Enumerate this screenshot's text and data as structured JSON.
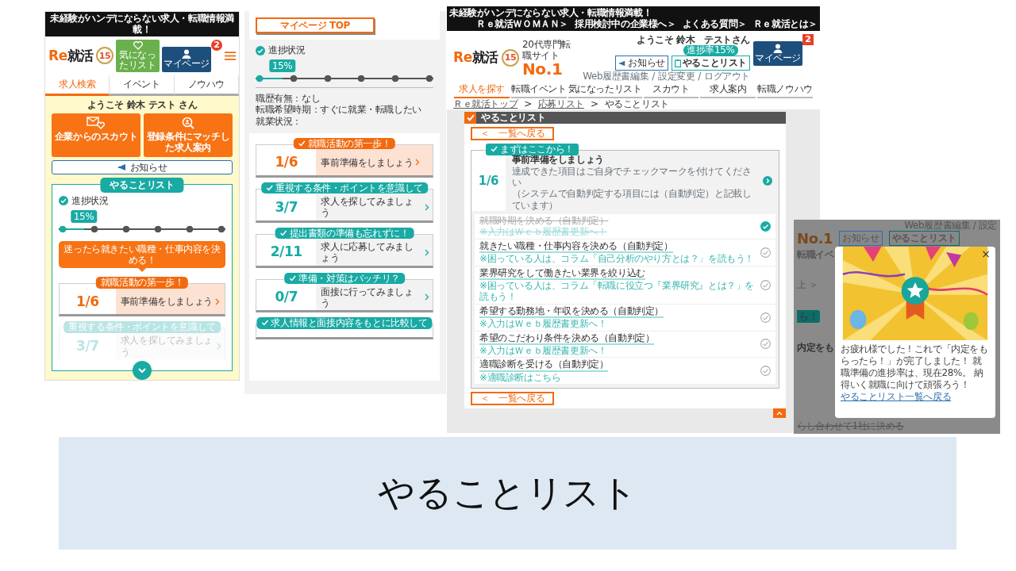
{
  "mobile_screen": {
    "top_banner": "未経験がハンデにならない求人・転職情報満載！",
    "logo": {
      "latin": "Re",
      "kanji": "就活"
    },
    "anniversary_badge": "15",
    "favorites_button": "気になったリスト",
    "mypage_button": "マイページ",
    "mypage_badge": "2",
    "tabs": [
      {
        "label": "求人検索",
        "selected": true
      },
      {
        "label": "イベント",
        "selected": false
      },
      {
        "label": "ノウハウ",
        "selected": false
      }
    ],
    "welcome": "ようこそ 鈴木 テスト さん",
    "action_buttons": [
      {
        "kind": "scout",
        "label": "企業からのスカウト"
      },
      {
        "kind": "match",
        "label": "登録条件にマッチした求人案内"
      }
    ],
    "notice_button": "お知らせ",
    "todo": {
      "title": "やることリスト",
      "progress": {
        "label": "進捗状況",
        "reading": "15%",
        "level": 0.15
      },
      "tip": "迷ったら就きたい職種・仕事内容を決める！",
      "steps": [
        {
          "tag": "就職活動の第一歩！",
          "count": "1/6",
          "action": "事前準備をしましょう",
          "current": true,
          "faded": false
        },
        {
          "tag": "重視する条件・ポイントを意識して",
          "count": "3/7",
          "action": "求人を探してみましょう",
          "current": false,
          "faded": true
        }
      ]
    }
  },
  "mypage_screen": {
    "top_button": "マイページ TOP",
    "progress": {
      "label": "進捗状況",
      "reading": "15%",
      "level": 0.15
    },
    "profile": [
      "職歴有無：なし",
      "転職希望時期：すぐに就業・転職したい",
      "就業状況："
    ],
    "steps": [
      {
        "tag": "就職活動の第一歩！",
        "count": "1/6",
        "action": "事前準備をしましょう",
        "current": true
      },
      {
        "tag": "重視する条件・ポイントを意識して",
        "count": "3/7",
        "action": "求人を探してみましょう",
        "current": false
      },
      {
        "tag": "提出書類の準備も忘れずに！",
        "count": "2/11",
        "action": "求人に応募してみましょう",
        "current": false
      },
      {
        "tag": "準備・対策はバッチリ？",
        "count": "0/7",
        "action": "面接に行ってみましょう",
        "current": false
      },
      {
        "tag": "求人情報と面接内容をもとに比較して",
        "current": false
      }
    ]
  },
  "desktop_screen": {
    "top_banner": "未経験がハンデにならない求人・転職情報満載！",
    "top_links": [
      "Ｒｅ就活ＷＯＭＡＮ＞",
      "採用検討中の企業様へ＞",
      "よくある質問＞",
      "Ｒｅ就活とは＞"
    ],
    "logo": {
      "latin": "Re",
      "kanji": "就活"
    },
    "anniversary_badge": "15",
    "tagline": "20代専門転職サイト",
    "rank": "No.1",
    "notice_button": "お知らせ",
    "todo_button": "やることリスト",
    "todo_progress": "進捗率15%",
    "greeting": "ようこそ 鈴木　テストさん",
    "account_links": [
      "Web履歴書編集",
      "設定変更",
      "ログアウト"
    ],
    "link_separator": "/",
    "mypage_button": "マイページ",
    "mypage_badge": "2",
    "nav": [
      {
        "label": "求人を探す",
        "selected": true
      },
      {
        "label": "転職イベント",
        "selected": false
      },
      {
        "label": "気になったリスト",
        "selected": false
      },
      {
        "label": "スカウト",
        "selected": false
      },
      {
        "label": "求人案内",
        "selected": false
      },
      {
        "label": "転職ノウハウ",
        "selected": false
      }
    ],
    "breadcrumb": [
      "Ｒｅ就活トップ",
      "応募リスト",
      "やることリスト"
    ],
    "breadcrumb_separator": ">",
    "section_title": "やることリスト",
    "back_buttons": [
      "＜　一覧へ戻る",
      "＜　一覧へ戻る"
    ],
    "step": {
      "tag": "まずはここから！",
      "count": "1/6",
      "title": "事前準備をしましょう",
      "notes": [
        "達成できた項目はご自身でチェックマークを付けてください",
        "（システムで自動判定する項目には（自動判定）と記載しています）"
      ]
    },
    "tasks": [
      {
        "title": "就職時期を決める（自動判定）",
        "note": "※入力はＷｅｂ履歴書更新へ！",
        "done": true
      },
      {
        "title": "就きたい職種・仕事内容を決める（自動判定）",
        "note": "※困っている人は、コラム「自己分析のやり方とは？」を読もう！",
        "done": false
      },
      {
        "title": "業界研究をして働きたい業界を絞り込む",
        "note": "※困っている人は、コラム「転職に役立つ『業界研究』とは？」を読もう！",
        "done": false
      },
      {
        "title": "希望する勤務地・年収を決める（自動判定）",
        "note": "※入力はＷｅｂ履歴書更新へ！",
        "done": false
      },
      {
        "title": "希望のこだわり条件を決める（自動判定）",
        "note": "※入力はＷｅｂ履歴書更新へ！",
        "done": false
      },
      {
        "title": "適職診断を受ける（自動判定）",
        "note": "※適職診断はこちら",
        "done": false
      }
    ]
  },
  "popup_screen": {
    "background": {
      "links": "Web履歴書編集 / 設定",
      "rank": "No.1",
      "notice_button": "お知らせ",
      "todo_button": "やることリスト",
      "fragments": [
        {
          "kind": "nav",
          "text": "転職イベ"
        },
        {
          "kind": "crumb",
          "text": "上 ＞"
        },
        {
          "kind": "tag",
          "text": "ら！"
        },
        {
          "kind": "heading",
          "text": "内定をも"
        }
      ],
      "struck_task": "らし合わせて1社に決める"
    },
    "dialog": {
      "close": "×",
      "message": "お疲れ様でした！これで「内定をもらったら！」が完了しました！ 就職準備の進捗率は、現在28%。 納得いく就職に向けて頑張ろう！",
      "link": "やることリスト一覧へ戻る"
    }
  },
  "caption": "やることリスト"
}
